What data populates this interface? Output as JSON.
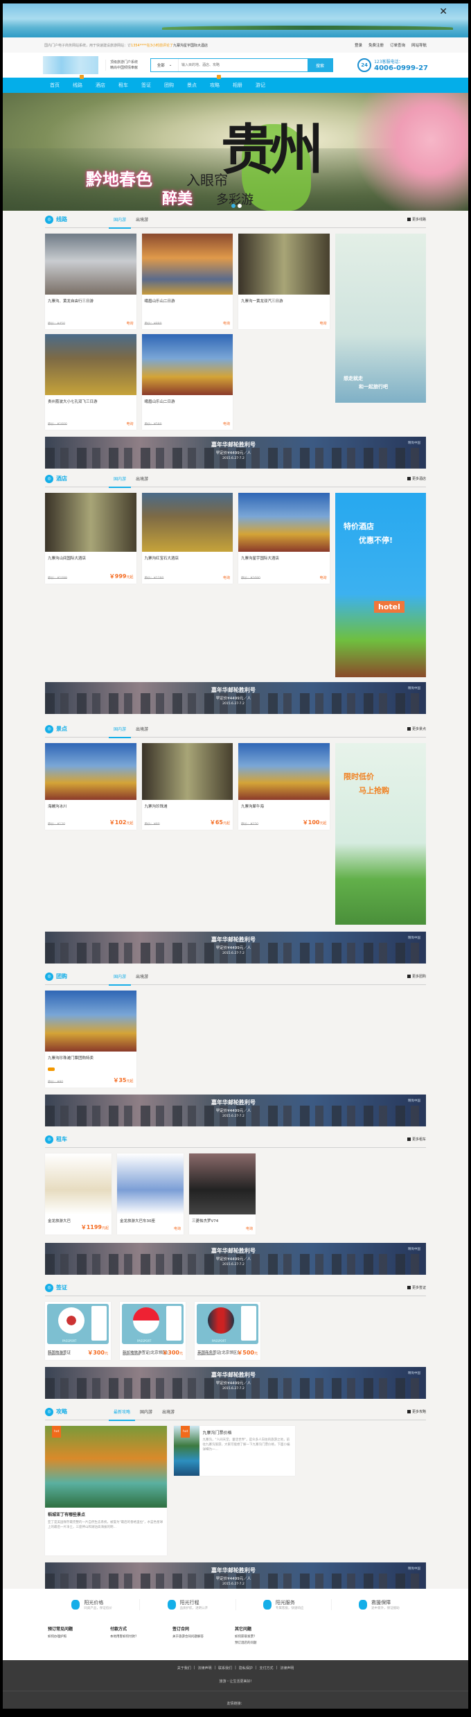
{
  "top_ad": {
    "close": "✕"
  },
  "topbar": {
    "notice": "国内门户电子商务网站系统，用于快速建设旅游网站：订",
    "highlight": "1354****在3小时前评论了",
    "hotel": "九寨沟星宇国际大酒店",
    "links": [
      "登录",
      "免费注册",
      "订单查询",
      "网站导航"
    ]
  },
  "header": {
    "slogan1": "顶级旅游门户系统",
    "slogan2": "精尚中国倾情奉献",
    "search_scope": "全部",
    "search_placeholder": "输入目的地、酒店、攻略",
    "search_button": "搜索",
    "phone_icon": "24",
    "phone_label": "123客服电话：",
    "phone": "4006-0999-27"
  },
  "nav": [
    "首页",
    "线路",
    "酒店",
    "租车",
    "签证",
    "团购",
    "景点",
    "攻略",
    "相册",
    "游记"
  ],
  "hero": {
    "line1": "黔地春色",
    "line1b": "入眼帘",
    "line2": "醉美",
    "line2b": "多彩游",
    "big": "贵州"
  },
  "promo": {
    "title": "嘉年华邮轮胜利号",
    "price": "早定价¥4499元／人",
    "date": "2015.6.27-7.2",
    "brand": "精尚中国"
  },
  "colors": {
    "accent": "#14aee8",
    "price": "#f46a1f",
    "nav": "#04aee9"
  },
  "sections": {
    "lines": {
      "title": "线路",
      "icon": "route-icon",
      "tabs": [
        "国内游",
        "出境游"
      ],
      "more": "更多线路",
      "ad": [
        "想走就走",
        "和一起旅行吧"
      ],
      "items": [
        {
          "name": "九寨沟、黄龙自由行三日游",
          "orig": "原价：¥450",
          "ask": "电询"
        },
        {
          "name": "峨眉山乐山二日游",
          "orig": "原价：¥880",
          "ask": "电询"
        },
        {
          "name": "九寨沟一黄龙双汽三日游",
          "orig": "",
          "ask": "电询"
        },
        {
          "name": "贵州荔波大小七孔双飞三日游",
          "orig": "原价：¥1600",
          "ask": "电询"
        },
        {
          "name": "峨眉山乐山二日游",
          "orig": "原价：¥580",
          "ask": "电询"
        }
      ]
    },
    "hotel": {
      "title": "酒店",
      "icon": "hotel-icon",
      "tabs": [
        "国内游",
        "出境游"
      ],
      "more": "更多酒店",
      "ad": [
        "特价酒店",
        "优惠不停!",
        "hotel"
      ],
      "items": [
        {
          "name": "九寨沟山间国际大酒店",
          "orig": "原价：¥1099",
          "price": "￥999",
          "unit": "元起"
        },
        {
          "name": "九寨沟红宝石大酒店",
          "orig": "原价：¥1280",
          "ask": "电询"
        },
        {
          "name": "九寨沟星宇国际大酒店",
          "orig": "原价：¥1680",
          "ask": "电询"
        }
      ]
    },
    "scenic": {
      "title": "景点",
      "icon": "scenic-icon",
      "tabs": [
        "国内游",
        "出境游"
      ],
      "more": "更多景点",
      "ad": [
        "限时低价",
        "马上抢购"
      ],
      "items": [
        {
          "name": "海螺沟冰川",
          "orig": "原价：¥120",
          "price": "￥102",
          "unit": "元起"
        },
        {
          "name": "九寨沟珍珠滩",
          "orig": "原价：¥80",
          "price": "￥65",
          "unit": "元起"
        },
        {
          "name": "九寨沟犀牛海",
          "orig": "原价：¥150",
          "price": "￥100",
          "unit": "元起"
        }
      ]
    },
    "group": {
      "title": "团购",
      "icon": "group-buy-icon",
      "tabs": [
        "国内游",
        "出境游"
      ],
      "more": "更多团购",
      "items": [
        {
          "name": "九寨沟珍珠滩门票团购特卖",
          "orig": "原价：¥80",
          "price": "￥35",
          "unit": "元起"
        }
      ]
    },
    "car": {
      "title": "租车",
      "icon": "car-icon",
      "more": "更多租车",
      "items": [
        {
          "name": "金龙旅游大巴",
          "price": "￥1199",
          "unit": "元起"
        },
        {
          "name": "金龙旅游大巴车30座",
          "ask": "电询"
        },
        {
          "name": "三菱帕杰罗V74",
          "ask": "电询"
        }
      ]
    },
    "visa": {
      "title": "签证",
      "icon": "visa-icon",
      "more": "更多签证",
      "passport": "PASSPORT",
      "items": [
        {
          "name": "韩国旅游签证",
          "orig": "原价：¥500",
          "price": "￥300",
          "unit": "元"
        },
        {
          "name": "新加坡旅游签证[北京领区]",
          "orig": "原价：¥500",
          "price": "￥300",
          "unit": "元"
        },
        {
          "name": "英国商务签证[北京领区]",
          "orig": "原价：¥600",
          "price": "￥500",
          "unit": "元"
        }
      ]
    },
    "guide": {
      "title": "攻略",
      "icon": "guide-icon",
      "tabs": [
        "最新攻略",
        "国内游",
        "出境游"
      ],
      "more": "更多攻略",
      "hot": "hot",
      "big": {
        "name": "稻城亚丁有哪些景点",
        "desc": "亚丁是美国保存最完整的一片自然生态系统，被誉为\"最后的香格里拉\"，水蓝色星球上的最后一片净土，三座神山和湖泊高海拔的明…"
      },
      "small": {
        "name": "九寨沟门票价格",
        "desc": "九寨沟，\"人间天堂，童话世界\"，是众多人向往的旅游之地，前往九寨沟旅游，大家可能想了解一下九寨沟门票价格，下面小编详细为一…"
      }
    }
  },
  "features": [
    {
      "title": "阳光价格",
      "desc": "同类产品，保证低价"
    },
    {
      "title": "阳光行程",
      "desc": "品质护航，透明公开"
    },
    {
      "title": "阳光服务",
      "desc": "专属客服，快速响应"
    },
    {
      "title": "救援保障",
      "desc": "途中意外，保证援助"
    }
  ],
  "help": [
    {
      "title": "预订常见问题",
      "links": [
        "如何办理护照"
      ]
    },
    {
      "title": "付款方式",
      "links": [
        "本地用客如何付款？"
      ]
    },
    {
      "title": "签订合同",
      "links": [
        "关于旅游合同问题解答"
      ]
    },
    {
      "title": "其它问题",
      "links": [
        "如何获取发票？",
        "预订酒店的问题"
      ]
    }
  ],
  "footer": {
    "links": [
      "关于我们",
      "法律声明",
      "联系我们",
      "隐私保护",
      "支付方式",
      "法律声明"
    ],
    "slogan": "旅游・让生活更美好!",
    "friends": "友情链接："
  }
}
